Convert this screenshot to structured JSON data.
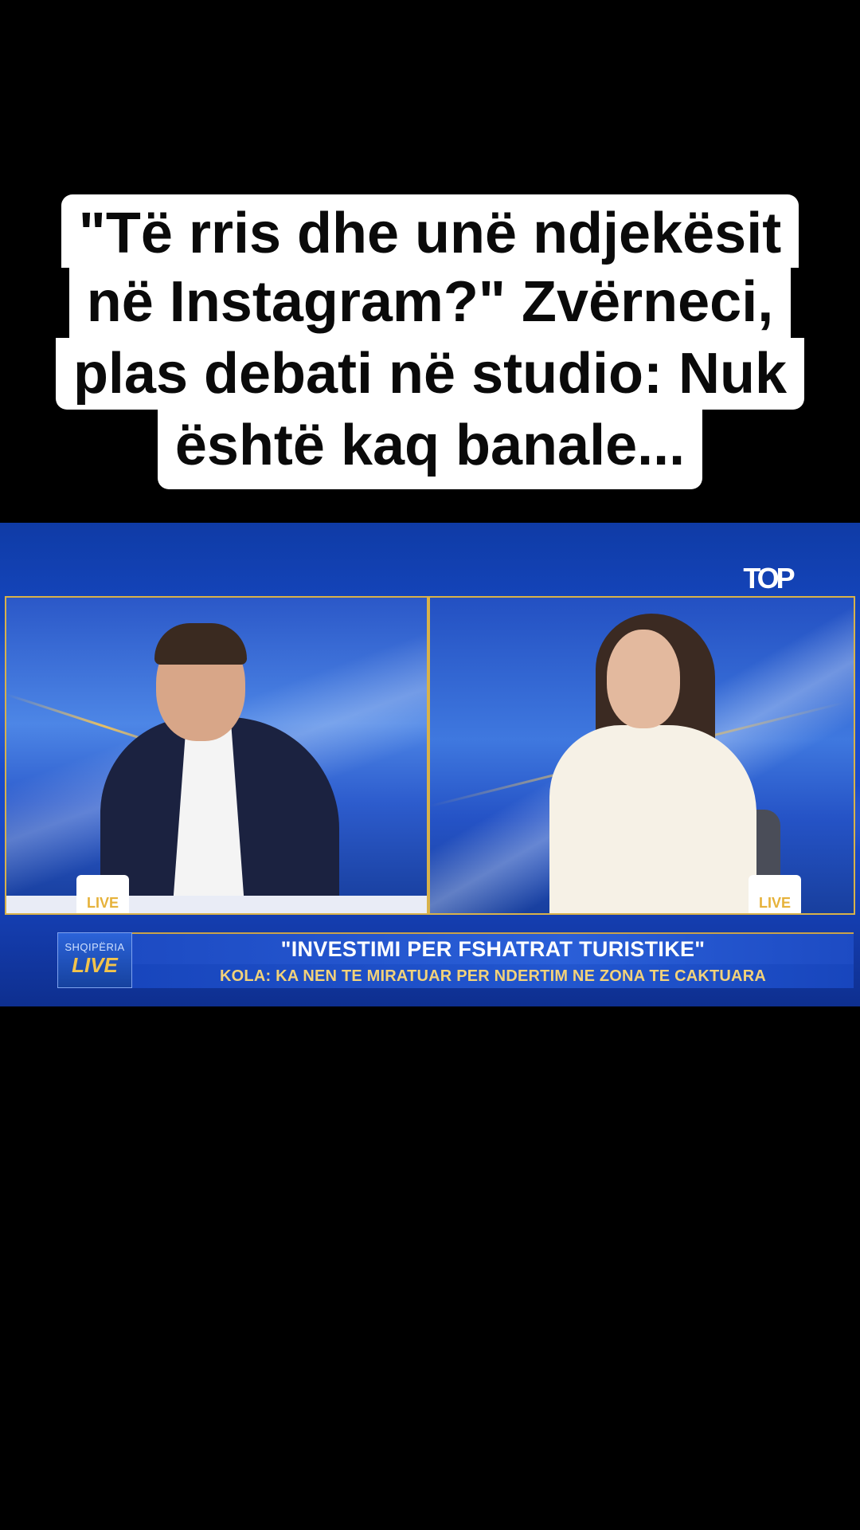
{
  "caption": {
    "line1": "\"Të rris dhe unë ndjekësit",
    "line2": "në Instagram?\" Zvërneci,",
    "line3": "plas debati në studio: Nuk",
    "line4": "është kaq banale..."
  },
  "broadcast": {
    "channel_logo": "TOP",
    "mug_label": "LIVE",
    "show_logo_small": "SHQIPËRIA",
    "show_logo_big": "LIVE",
    "headline": "\"INVESTIMI PER FSHATRAT TURISTIKE\"",
    "subheadline": "KOLA: KA NEN TE MIRATUAR PER NDERTIM NE ZONA TE CAKTUARA"
  },
  "colors": {
    "background": "#000000",
    "caption_bg": "#ffffff",
    "studio_blue": "#1a4fd0",
    "accent_gold": "#e8c063"
  }
}
